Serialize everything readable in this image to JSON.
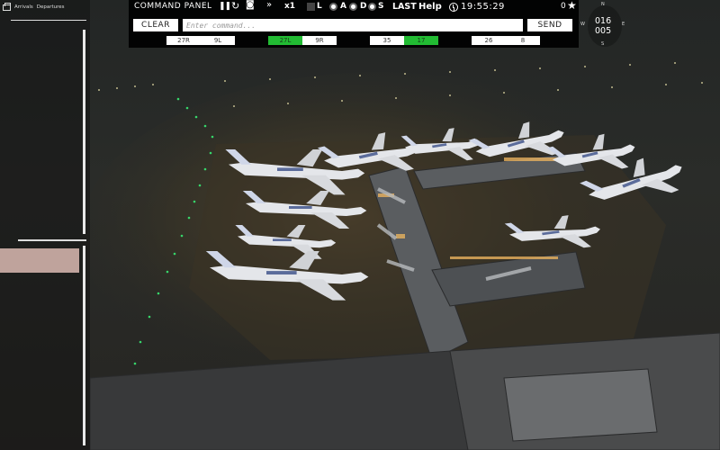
{
  "left_panel": {
    "tabs": [
      {
        "label": "Arrivals"
      },
      {
        "label": "Departures"
      }
    ]
  },
  "command_panel": {
    "title": "COMMAND PANEL",
    "speed": "x1",
    "letters": [
      "L",
      "A",
      "D",
      "S"
    ],
    "last_label": "LAST",
    "help_label": "Help",
    "clock": "19:55:29",
    "score": "0",
    "clear_label": "CLEAR",
    "send_label": "SEND",
    "input_placeholder": "Enter command...",
    "runways": [
      {
        "label": "27R",
        "active": false
      },
      {
        "label": "9L",
        "active": false
      },
      {
        "label": "27L",
        "active": true
      },
      {
        "label": "9R",
        "active": false
      },
      {
        "label": "35",
        "active": false
      },
      {
        "label": "17",
        "active": true
      },
      {
        "label": "26",
        "active": false
      },
      {
        "label": "8",
        "active": false
      }
    ]
  },
  "compass": {
    "n": "N",
    "s": "S",
    "e": "E",
    "w": "W",
    "heading": "016",
    "wind": "005"
  },
  "colors": {
    "runway_active": "#22bb33",
    "flight_strip": "#bfa39c",
    "panel_bg": "#000000"
  },
  "icons": [
    "flights-icon",
    "pause-icon",
    "restart-icon",
    "camera-icon",
    "fast-forward-icon",
    "clock-icon",
    "star-icon"
  ]
}
